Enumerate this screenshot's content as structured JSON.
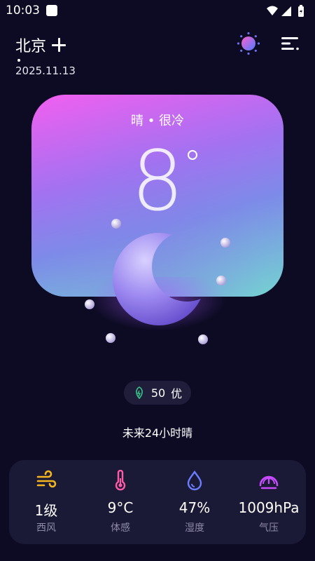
{
  "status_bar": {
    "time": "10:03"
  },
  "header": {
    "city": "北京",
    "date": "2025.11.13"
  },
  "weather": {
    "condition": "晴 • 很冷",
    "temperature": "8",
    "aqi_value": "50",
    "aqi_level": "优",
    "forecast": "未来24小时晴"
  },
  "stats": [
    {
      "icon": "wind-icon",
      "value": "1级",
      "label": "西风",
      "color": "#f5b51e"
    },
    {
      "icon": "thermometer-icon",
      "value": "9°C",
      "label": "体感",
      "color": "#ff5aa7"
    },
    {
      "icon": "water-drop-icon",
      "value": "47%",
      "label": "湿度",
      "color": "#6a7dff"
    },
    {
      "icon": "gauge-icon",
      "value": "1009hPa",
      "label": "气压",
      "color": "#c84bff"
    }
  ],
  "colors": {
    "background": "#0d0b24",
    "card_top": "#f25ff0",
    "card_bottom": "#74d3d1",
    "panel": "#1b1a36",
    "aqi_green": "#38c58a"
  }
}
